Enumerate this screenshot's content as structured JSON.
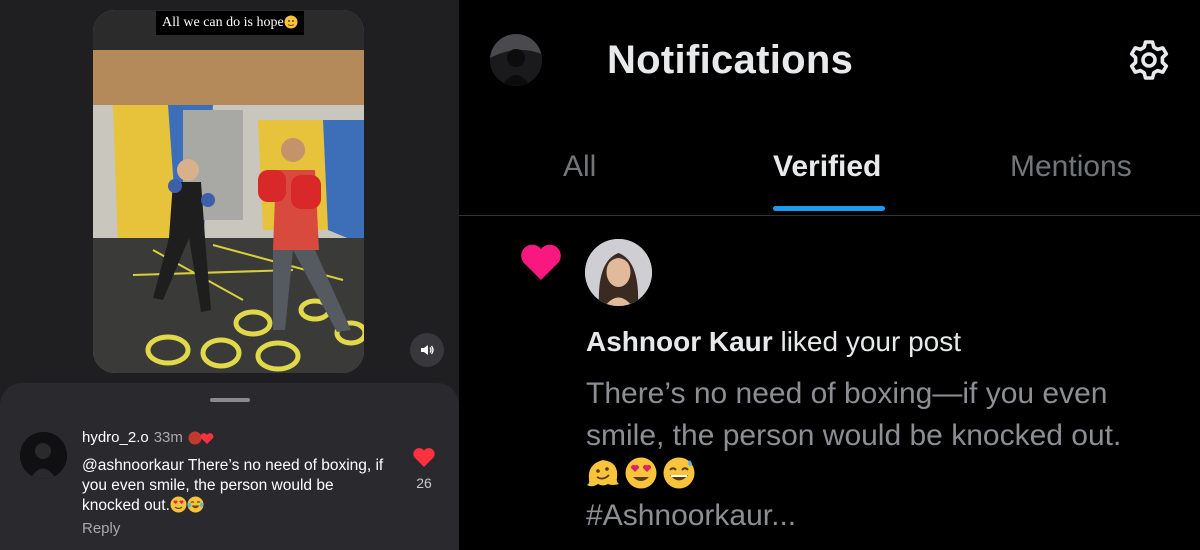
{
  "left": {
    "video_caption": "All we can do is hope",
    "comment": {
      "username": "hydro_2.o",
      "time": "33m",
      "text": "@ashnoorkaur There’s no need of boxing, if you even smile, the person would be knocked out.",
      "reply_label": "Reply",
      "like_count": "26"
    }
  },
  "right": {
    "title": "Notifications",
    "tabs": [
      {
        "label": "All",
        "active": false
      },
      {
        "label": "Verified",
        "active": true
      },
      {
        "label": "Mentions",
        "active": false
      }
    ],
    "notification": {
      "user": "Ashnoor Kaur",
      "action": "liked your post",
      "text": "There’s no need of boxing—if you even smile, the person would be knocked out.",
      "hashtag": "#Ashnoorkaur..."
    }
  },
  "colors": {
    "accent": "#1d9bf0",
    "like_heart": "#f91880",
    "comment_heart": "#ff3040"
  },
  "icons": [
    "sound-icon",
    "heart-icon",
    "gear-icon",
    "like-heart-icon"
  ]
}
